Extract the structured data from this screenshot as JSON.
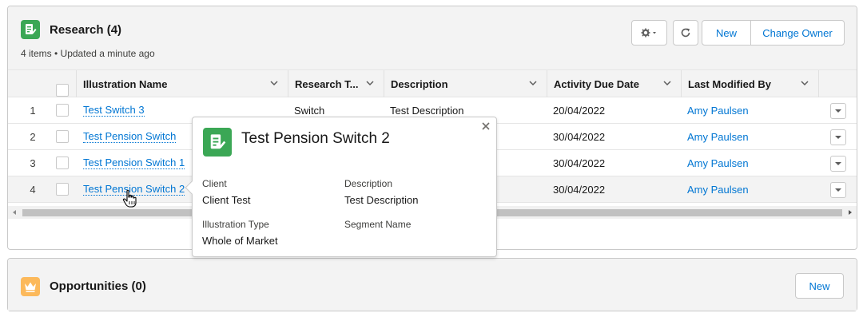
{
  "research": {
    "title": "Research (4)",
    "subtitle": "4 items • Updated a minute ago",
    "icon": "research-doc-icon",
    "icon_color": "#3ba755",
    "buttons": {
      "new": "New",
      "change_owner": "Change Owner"
    },
    "columns": [
      "Illustration Name",
      "Research T...",
      "Description",
      "Activity Due Date",
      "Last Modified By"
    ],
    "rows": [
      {
        "num": "1",
        "name": "Test Switch 3",
        "type": "Switch",
        "description": "Test Description",
        "due": "20/04/2022",
        "modified_by": "Amy Paulsen"
      },
      {
        "num": "2",
        "name": "Test Pension Switch",
        "type": "",
        "description": "",
        "due": "30/04/2022",
        "modified_by": "Amy Paulsen"
      },
      {
        "num": "3",
        "name": "Test Pension Switch 1",
        "type": "",
        "description": "",
        "due": "30/04/2022",
        "modified_by": "Amy Paulsen"
      },
      {
        "num": "4",
        "name": "Test Pension Switch 2",
        "type": "",
        "description": "",
        "due": "30/04/2022",
        "modified_by": "Amy Paulsen"
      }
    ]
  },
  "popover": {
    "title": "Test Pension Switch 2",
    "client_label": "Client",
    "client_value": "Client Test",
    "description_label": "Description",
    "description_value": "Test Description",
    "type_label": "Illustration Type",
    "type_value": "Whole of Market",
    "segment_label": "Segment Name",
    "segment_value": ""
  },
  "opportunities": {
    "title": "Opportunities (0)",
    "icon": "crown-icon",
    "icon_color": "#fcb95b",
    "new_label": "New"
  },
  "colors": {
    "link": "#0176d3",
    "header_bg": "#f3f3f3",
    "border": "#c9c9c9"
  }
}
